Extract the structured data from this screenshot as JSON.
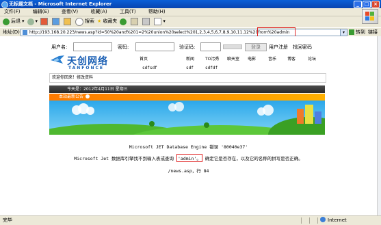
{
  "window": {
    "title": "无标题文档 - Microsoft Internet Explorer"
  },
  "menu": [
    "文件(F)",
    "编辑(E)",
    "查看(V)",
    "收藏(A)",
    "工具(T)",
    "帮助(H)"
  ],
  "toolbar": {
    "back_label": "后退",
    "search_label": "搜索",
    "favorites_label": "收藏夹"
  },
  "address": {
    "label": "地址(D)",
    "url": "http://193.168.20.223/news.asp?id=50%20and%201=2%20union%20select%201,2,3,4,5,6,7,8,9,10,11,12%20from%20admin",
    "go_label": "转到",
    "links_label": "链接"
  },
  "site": {
    "login": {
      "username_label": "用户名:",
      "password_label": "密码:",
      "captcha_label": "验证码:",
      "login_button": "登录",
      "register_link": "用户注册",
      "forgot_link": "找回密码"
    },
    "logo": {
      "cn": "天创网络",
      "en": "TANFONCE"
    },
    "nav_top": [
      "首页",
      "新闻",
      "TO污秀",
      "聊天室",
      "电影",
      "音乐",
      "博客",
      "论坛"
    ],
    "nav_injected": [
      "sdfsdf",
      "sdf",
      "sdfdf"
    ],
    "welcome": "欢迎你回来！修改资料",
    "date": "今天是：2012年4月11日 星期三",
    "notice": "本站最新公告"
  },
  "error": {
    "line1": "Microsoft JET Database Engine 错误 '80040e37'",
    "line2_pre": "Microsoft Jet 数据库引擎找不到输入表或查询",
    "line2_hl": "'admin'。",
    "line2_post": "确定它是否存在，以及它的名称的拼写是否正确。",
    "line3": "/news.asp，行 84"
  },
  "status": {
    "left": "完毕",
    "zone": "Internet"
  }
}
